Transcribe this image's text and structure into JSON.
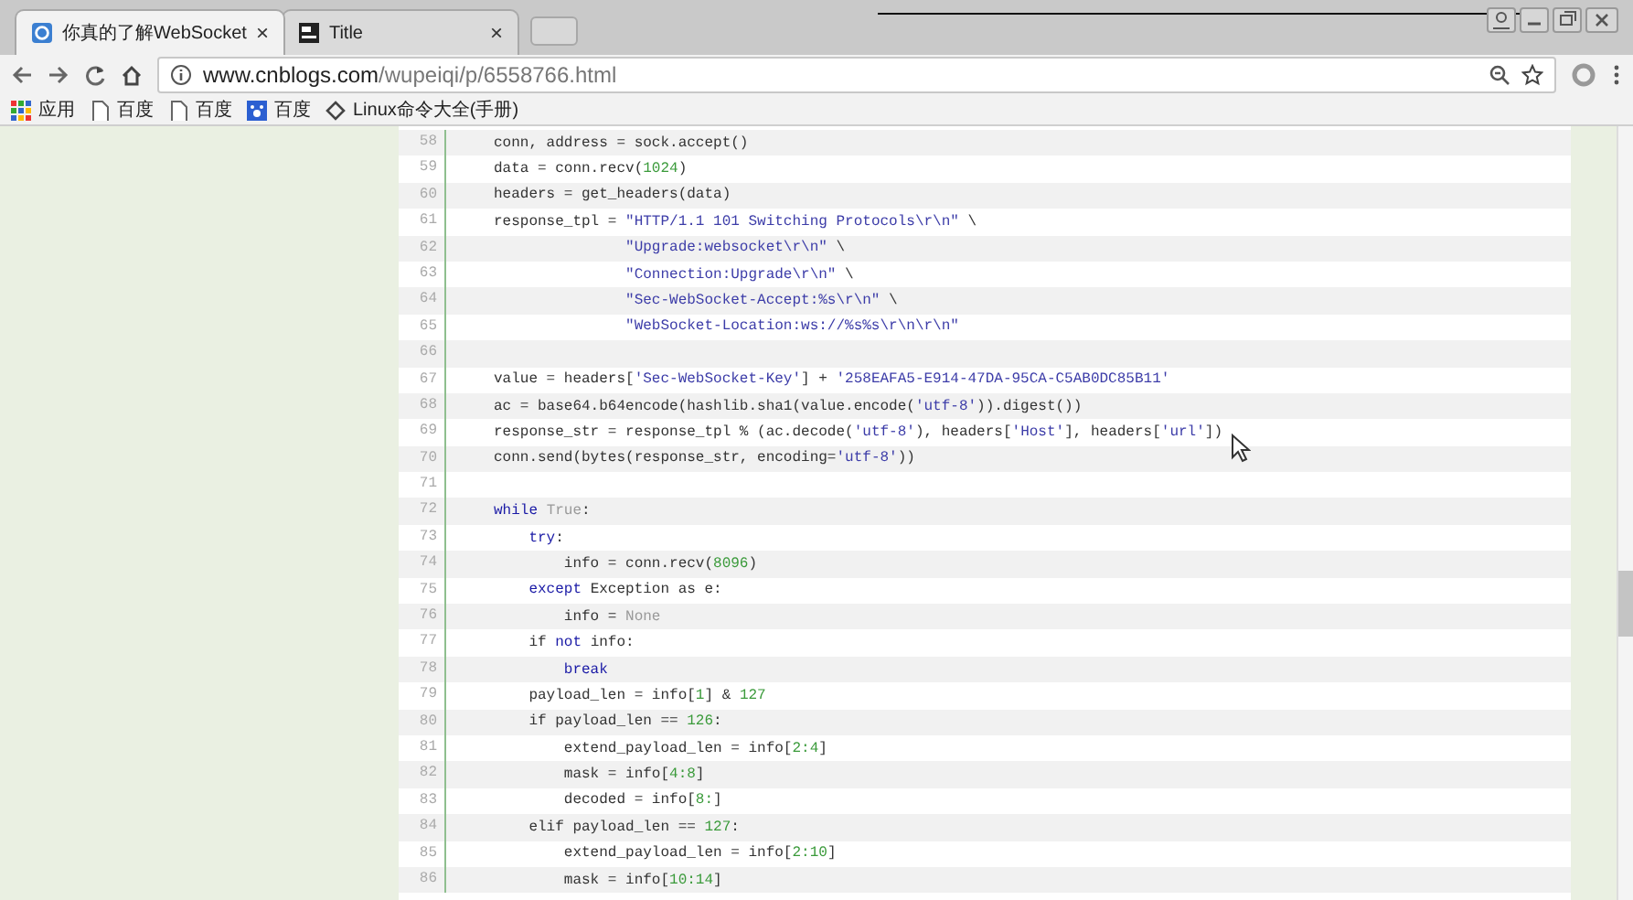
{
  "tabs": [
    {
      "title": "你真的了解WebSocket",
      "selected": true,
      "close": "×"
    },
    {
      "title": "Title",
      "selected": false,
      "close": "×"
    }
  ],
  "address_bar": {
    "url_host": "www.cnblogs.com",
    "url_path": "/wupeiqi/p/6558766.html"
  },
  "bookmarks": [
    {
      "label": "应用",
      "kind": "apps"
    },
    {
      "label": "百度",
      "kind": "page"
    },
    {
      "label": "百度",
      "kind": "page"
    },
    {
      "label": "百度",
      "kind": "paw"
    },
    {
      "label": "Linux命令大全(手册)",
      "kind": "diamond"
    }
  ],
  "code": [
    {
      "number": "58",
      "segments": [
        {
          "kind": "plain",
          "text": "conn, address = sock.accept()"
        }
      ]
    },
    {
      "number": "59",
      "segments": [
        {
          "kind": "plain",
          "text": "data = conn.recv("
        },
        {
          "kind": "number",
          "text": "1024"
        },
        {
          "kind": "plain",
          "text": ")"
        }
      ]
    },
    {
      "number": "60",
      "segments": [
        {
          "kind": "plain",
          "text": "headers = get_headers(data)"
        }
      ]
    },
    {
      "number": "61",
      "segments": [
        {
          "kind": "plain",
          "text": "response_tpl = "
        },
        {
          "kind": "string",
          "text": "\"HTTP/1.1 101 Switching Protocols\\r\\n\""
        },
        {
          "kind": "plain",
          "text": " \\"
        }
      ]
    },
    {
      "number": "62",
      "segments": [
        {
          "kind": "string",
          "text": "               \"Upgrade:websocket\\r\\n\""
        },
        {
          "kind": "plain",
          "text": " \\"
        }
      ]
    },
    {
      "number": "63",
      "segments": [
        {
          "kind": "string",
          "text": "               \"Connection:Upgrade\\r\\n\""
        },
        {
          "kind": "plain",
          "text": " \\"
        }
      ]
    },
    {
      "number": "64",
      "segments": [
        {
          "kind": "string",
          "text": "               \"Sec-WebSocket-Accept:%s\\r\\n\""
        },
        {
          "kind": "plain",
          "text": " \\"
        }
      ]
    },
    {
      "number": "65",
      "segments": [
        {
          "kind": "string",
          "text": "               \"WebSocket-Location:ws://%s%s\\r\\n\\r\\n\""
        }
      ]
    },
    {
      "number": "66"
    },
    {
      "number": "67",
      "segments": [
        {
          "kind": "plain",
          "text": "value = headers["
        },
        {
          "kind": "string",
          "text": "'Sec-WebSocket-Key'"
        },
        {
          "kind": "plain",
          "text": "] + "
        },
        {
          "kind": "string",
          "text": "'258EAFA5-E914-47DA-95CA-C5AB0DC85B11'"
        }
      ]
    },
    {
      "number": "68",
      "segments": [
        {
          "kind": "plain",
          "text": "ac = base64.b64encode(hashlib.sha1(value.encode("
        },
        {
          "kind": "string",
          "text": "'utf-8'"
        },
        {
          "kind": "plain",
          "text": ")).digest())"
        }
      ]
    },
    {
      "number": "69",
      "segments": [
        {
          "kind": "plain",
          "text": "response_str = response_tpl % (ac.decode("
        },
        {
          "kind": "string",
          "text": "'utf-8'"
        },
        {
          "kind": "plain",
          "text": "), headers["
        },
        {
          "kind": "string",
          "text": "'Host'"
        },
        {
          "kind": "plain",
          "text": "], headers["
        },
        {
          "kind": "string",
          "text": "'url'"
        },
        {
          "kind": "plain",
          "text": "])"
        }
      ]
    },
    {
      "number": "70",
      "segments": [
        {
          "kind": "plain",
          "text": "conn.send(bytes(response_str, encoding="
        },
        {
          "kind": "string",
          "text": "'utf-8'"
        },
        {
          "kind": "plain",
          "text": "))"
        }
      ]
    },
    {
      "number": "71"
    },
    {
      "number": "72",
      "segments": [
        {
          "kind": "keyword",
          "text": "while"
        },
        {
          "kind": "constant",
          "text": " True"
        },
        {
          "kind": "plain",
          "text": ":"
        }
      ]
    },
    {
      "number": "73",
      "segments": [
        {
          "kind": "keyword",
          "text": "    try"
        },
        {
          "kind": "plain",
          "text": ":"
        }
      ]
    },
    {
      "number": "74",
      "segments": [
        {
          "kind": "plain",
          "text": "        info = conn.recv("
        },
        {
          "kind": "number",
          "text": "8096"
        },
        {
          "kind": "plain",
          "text": ")"
        }
      ]
    },
    {
      "number": "75",
      "segments": [
        {
          "kind": "keyword",
          "text": "    except"
        },
        {
          "kind": "plain",
          "text": " Exception as e:"
        }
      ]
    },
    {
      "number": "76",
      "segments": [
        {
          "kind": "plain",
          "text": "        info = "
        },
        {
          "kind": "constant",
          "text": "None"
        }
      ]
    },
    {
      "number": "77",
      "segments": [
        {
          "kind": "plain",
          "text": "    if "
        },
        {
          "kind": "keyword",
          "text": "not"
        },
        {
          "kind": "plain",
          "text": " info:"
        }
      ]
    },
    {
      "number": "78",
      "segments": [
        {
          "kind": "keyword",
          "text": "        break"
        }
      ]
    },
    {
      "number": "79",
      "segments": [
        {
          "kind": "plain",
          "text": "    payload_len = info["
        },
        {
          "kind": "number",
          "text": "1"
        },
        {
          "kind": "plain",
          "text": "] & "
        },
        {
          "kind": "number",
          "text": "127"
        }
      ]
    },
    {
      "number": "80",
      "segments": [
        {
          "kind": "plain",
          "text": "    if payload_len == "
        },
        {
          "kind": "number",
          "text": "126"
        },
        {
          "kind": "plain",
          "text": ":"
        }
      ]
    },
    {
      "number": "81",
      "segments": [
        {
          "kind": "plain",
          "text": "        extend_payload_len = info["
        },
        {
          "kind": "number",
          "text": "2:4"
        },
        {
          "kind": "plain",
          "text": "]"
        }
      ]
    },
    {
      "number": "82",
      "segments": [
        {
          "kind": "plain",
          "text": "        mask = info["
        },
        {
          "kind": "number",
          "text": "4:8"
        },
        {
          "kind": "plain",
          "text": "]"
        }
      ]
    },
    {
      "number": "83",
      "segments": [
        {
          "kind": "plain",
          "text": "        decoded = info["
        },
        {
          "kind": "number",
          "text": "8:"
        },
        {
          "kind": "plain",
          "text": "]"
        }
      ]
    },
    {
      "number": "84",
      "segments": [
        {
          "kind": "plain",
          "text": "    elif payload_len == "
        },
        {
          "kind": "number",
          "text": "127"
        },
        {
          "kind": "plain",
          "text": ":"
        }
      ]
    },
    {
      "number": "85",
      "segments": [
        {
          "kind": "plain",
          "text": "        extend_payload_len = info["
        },
        {
          "kind": "number",
          "text": "2:10"
        },
        {
          "kind": "plain",
          "text": "]"
        }
      ]
    },
    {
      "number": "86",
      "segments": [
        {
          "kind": "plain",
          "text": "        mask = info["
        },
        {
          "kind": "number",
          "text": "10:14"
        },
        {
          "kind": "plain",
          "text": "]"
        }
      ]
    }
  ]
}
